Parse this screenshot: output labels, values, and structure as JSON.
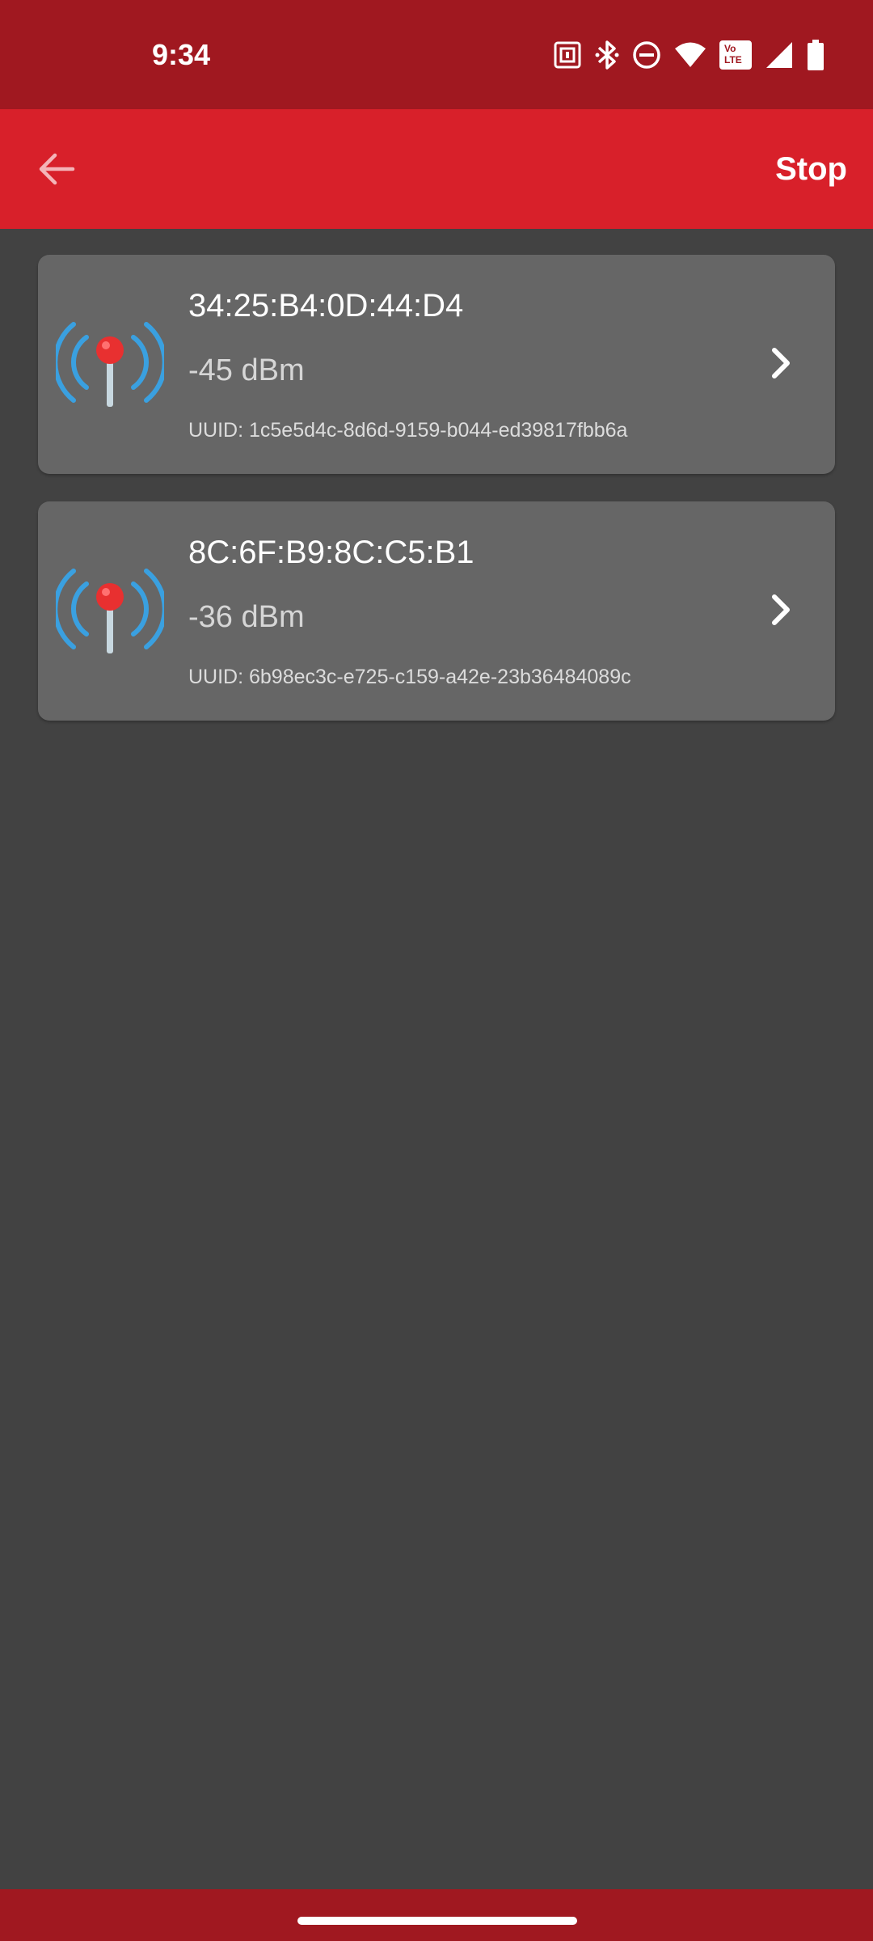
{
  "status_bar": {
    "time": "9:34",
    "icons": [
      "nfc-icon",
      "bluetooth-icon",
      "do-not-disturb-icon",
      "wifi-icon",
      "volte-icon",
      "cellular-signal-icon",
      "battery-icon"
    ],
    "volte_label_top": "Vo",
    "volte_label_bottom": "LTE"
  },
  "app_bar": {
    "back_icon": "arrow-left-icon",
    "action_label": "Stop"
  },
  "beacons": [
    {
      "address": "34:25:B4:0D:44:D4",
      "rssi": "-45 dBm",
      "uuid": "UUID: 1c5e5d4c-8d6d-9159-b044-ed39817fbb6a"
    },
    {
      "address": "8C:6F:B9:8C:C5:B1",
      "rssi": "-36 dBm",
      "uuid": "UUID: 6b98ec3c-e725-c159-a42e-23b36484089c"
    }
  ],
  "colors": {
    "status_bar": "#a01820",
    "app_bar": "#d8202a",
    "background": "#424242",
    "card": "#666666",
    "signal_waves": "#3aa0e0",
    "pin_head": "#e83030"
  }
}
